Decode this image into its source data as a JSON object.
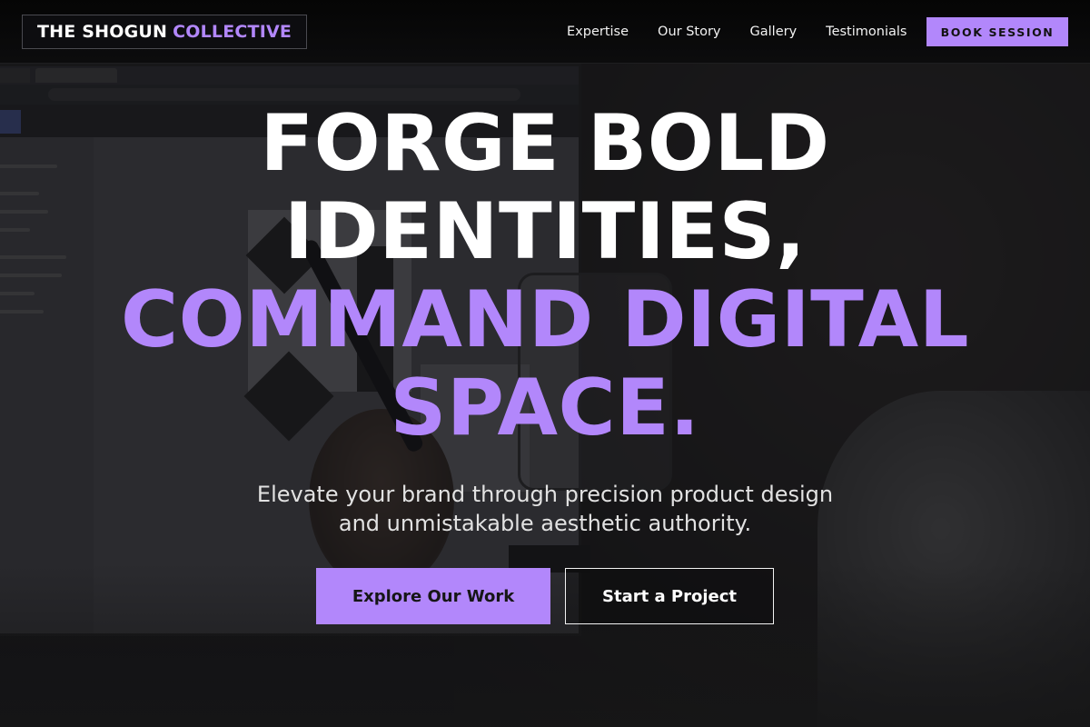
{
  "header": {
    "logo_main": "THE SHOGUN",
    "logo_accent": "COLLECTIVE",
    "nav": [
      "Expertise",
      "Our Story",
      "Gallery",
      "Testimonials"
    ],
    "cta_label": "BOOK SESSION"
  },
  "hero": {
    "title_line1": "FORGE BOLD",
    "title_line2": "IDENTITIES,",
    "title_line3": "COMMAND DIGITAL",
    "title_line4": "SPACE.",
    "subtitle_line1": "Elevate your brand through precision product design",
    "subtitle_line2": "and unmistakable aesthetic authority.",
    "primary_button": "Explore Our Work",
    "secondary_button": "Start a Project"
  },
  "colors": {
    "accent": "#b287fb",
    "background": "#0b0b0c",
    "text": "#ffffff"
  }
}
